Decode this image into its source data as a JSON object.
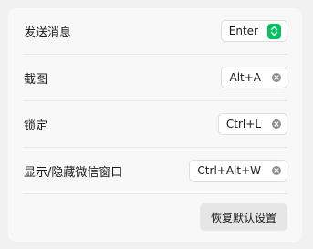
{
  "shortcuts": [
    {
      "label": "发送消息",
      "key": "Enter",
      "control": "select",
      "icon": "updown-select-icon"
    },
    {
      "label": "截图",
      "key": "Alt+A",
      "control": "clear",
      "icon": "clear-icon"
    },
    {
      "label": "锁定",
      "key": "Ctrl+L",
      "control": "clear",
      "icon": "clear-icon"
    },
    {
      "label": "显示/隐藏微信窗口",
      "key": "Ctrl+Alt+W",
      "control": "clear",
      "icon": "clear-icon"
    }
  ],
  "footer": {
    "reset_label": "恢复默认设置"
  },
  "colors": {
    "accent": "#07c160",
    "clear_icon": "#8e8e8e"
  }
}
